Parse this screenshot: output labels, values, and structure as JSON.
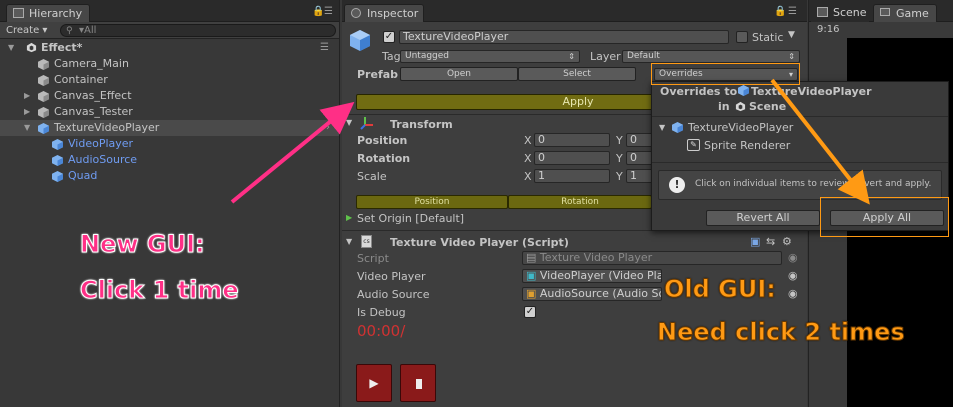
{
  "hierarchy": {
    "tab_label": "Hierarchy",
    "create_label": "Create ▾",
    "search_placeholder": "▾All",
    "scene_name": "Effect*",
    "items": [
      {
        "label": "Camera_Main"
      },
      {
        "label": "Container"
      },
      {
        "label": "Canvas_Effect"
      },
      {
        "label": "Canvas_Tester"
      },
      {
        "label": "TextureVideoPlayer"
      },
      {
        "label": "VideoPlayer"
      },
      {
        "label": "AudioSource"
      },
      {
        "label": "Quad"
      }
    ]
  },
  "inspector": {
    "tab_label": "Inspector",
    "object_name": "TextureVideoPlayer",
    "static_label": "Static",
    "tag_label": "Tag",
    "tag_value": "Untagged",
    "layer_label": "Layer",
    "layer_value": "Default",
    "prefab_label": "Prefab",
    "open_label": "Open",
    "select_label": "Select",
    "overrides_label": "Overrides",
    "apply_label": "Apply",
    "transform": {
      "title": "Transform",
      "position_label": "Position",
      "rotation_label": "Rotation",
      "scale_label": "Scale",
      "x_label": "X",
      "y_label": "Y",
      "position_x": "0",
      "position_y": "0",
      "rotation_x": "0",
      "rotation_y": "0",
      "scale_x": "1",
      "scale_y": "1",
      "position_btn": "Position",
      "rotation_btn": "Rotation",
      "set_origin": "Set Origin [Default]"
    },
    "script": {
      "title": "Texture Video Player (Script)",
      "script_label": "Script",
      "script_value": "Texture Video Player",
      "video_player_label": "Video Player",
      "video_player_value": "VideoPlayer (Video Playe",
      "audio_source_label": "Audio Source",
      "audio_source_value": "AudioSource (Audio So",
      "is_debug_label": "Is Debug",
      "time_text": "00:00/"
    }
  },
  "popup": {
    "title_prefix": "Overrides to",
    "title_object": "TextureVideoPlayer",
    "in_label": "in",
    "scene_label": "Scene",
    "tree_root": "TextureVideoPlayer",
    "tree_child": "Sprite Renderer",
    "info_text": "Click on individual items to review, revert and apply.",
    "revert_all": "Revert All",
    "apply_all": "Apply All"
  },
  "scene": {
    "scene_tab": "Scene",
    "game_tab": "Game",
    "aspect": "9:16"
  },
  "annotations": {
    "new_gui_line1": "New GUI:",
    "new_gui_line2": "Click 1 time",
    "old_gui_line1": "Old GUI:",
    "old_gui_line2": "Need click 2 times"
  },
  "colors": {
    "pink": "#ff2f86",
    "orange": "#ff9a14",
    "olive_apply": "#716c12",
    "debug_red": "#d03232"
  }
}
